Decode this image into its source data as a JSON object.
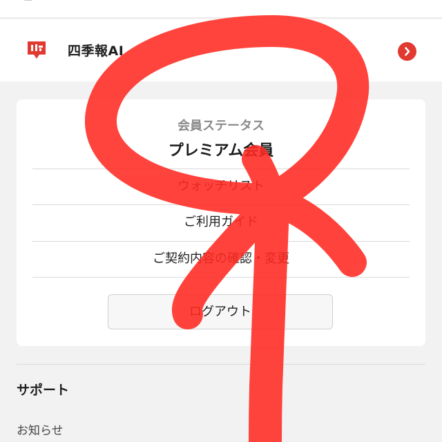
{
  "header": {
    "app_name": "四季報AI",
    "logo_icon": "shikiho-logo-icon",
    "chevron_icon": "chevron-right-icon",
    "accent_color": "#e03a31"
  },
  "membership": {
    "status_label": "会員ステータス",
    "status_value": "プレミアム会員",
    "links": [
      {
        "label": "ウォッチリスト"
      },
      {
        "label": "ご利用ガイド"
      },
      {
        "label": "ご契約内容の確認・変更"
      }
    ],
    "logout_label": "ログアウト"
  },
  "support": {
    "title": "サポート",
    "items": [
      {
        "label": "お知らせ"
      }
    ]
  },
  "annotation": {
    "color": "#ff2a22",
    "shape": "hand-drawn-ribbon"
  }
}
